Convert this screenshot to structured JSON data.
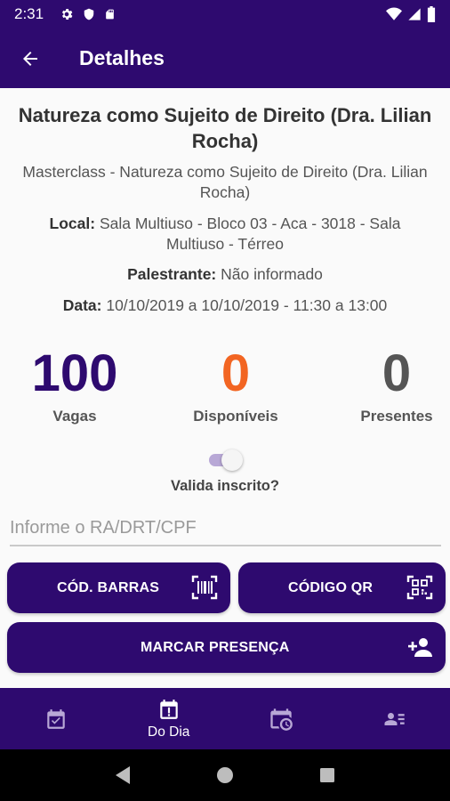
{
  "status_bar": {
    "time": "2:31"
  },
  "app_bar": {
    "title": "Detalhes"
  },
  "event": {
    "title": "Natureza como Sujeito de Direito (Dra. Lilian Rocha)",
    "subtitle": "Masterclass - Natureza como Sujeito de Direito (Dra. Lilian Rocha)",
    "local_label": "Local:",
    "local_value": " Sala Multiuso - Bloco 03 - Aca - 3018 - Sala Multiuso - Térreo",
    "speaker_label": "Palestrante:",
    "speaker_value": " Não informado",
    "date_label": "Data:",
    "date_value": " 10/10/2019 a 10/10/2019 - 11:30 a 13:00"
  },
  "stats": {
    "vagas": {
      "value": "100",
      "label": "Vagas",
      "color": "#2e0a6f"
    },
    "disponiveis": {
      "value": "0",
      "label": "Disponíveis",
      "color": "#f26522"
    },
    "presentes": {
      "value": "0",
      "label": "Presentes",
      "color": "#555555"
    }
  },
  "validate": {
    "label": "Valida inscrito?",
    "enabled": true
  },
  "search": {
    "placeholder": "Informe o RA/DRT/CPF",
    "value": ""
  },
  "buttons": {
    "barcode": "CÓD. BARRAS",
    "qr": "CÓDIGO QR",
    "presence": "MARCAR PRESENÇA"
  },
  "bottom_nav": {
    "items": [
      {
        "icon": "calendar-check-icon",
        "label": ""
      },
      {
        "icon": "calendar-alert-icon",
        "label": "Do Dia"
      },
      {
        "icon": "calendar-clock-icon",
        "label": ""
      },
      {
        "icon": "contact-list-icon",
        "label": ""
      }
    ]
  },
  "colors": {
    "primary": "#2e0a6f",
    "accent": "#f26522"
  }
}
